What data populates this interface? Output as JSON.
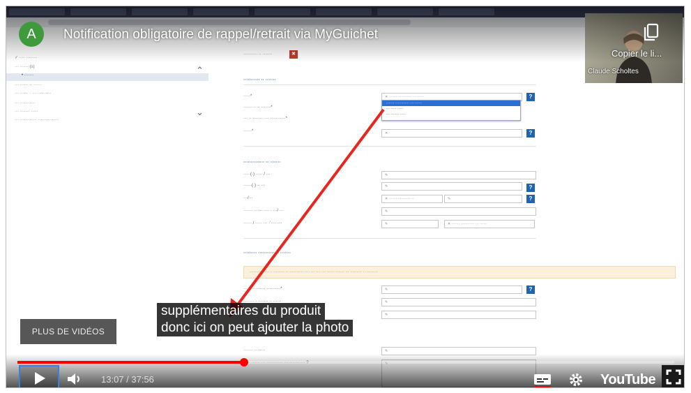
{
  "video": {
    "channel_initial": "A",
    "title": "Notification obligatoire de rappel/retrait via MyGuichet",
    "share_label": "Copier le li...",
    "more_videos": "PLUS DE VIDÉOS",
    "caption_lines": [
      "supplémentaires du produit",
      "donc ici on peut ajouter la photo"
    ],
    "time_current": "13:07",
    "time_total": "37:56",
    "timecode": "13:07 / 37:56",
    "progress": 0.345,
    "logo": "YouTube",
    "colors": {
      "progress": "#ff0000",
      "avatar": "#3f9a3c",
      "arrow": "#e8251f"
    }
  },
  "webcam": {
    "name": "Claude Scholtes"
  },
  "icons": [
    "play-icon",
    "volume-icon",
    "captions-icon",
    "gear-icon",
    "fullscreen-icon",
    "copy-icon"
  ]
}
